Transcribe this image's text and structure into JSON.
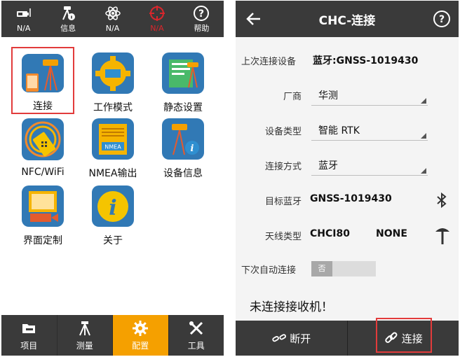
{
  "left": {
    "topbar": [
      {
        "label": "N/A",
        "icon": "receiver-battery-icon",
        "color": "#ffffff"
      },
      {
        "label": "信息",
        "icon": "receiver-info-icon",
        "color": "#ffffff"
      },
      {
        "label": "N/A",
        "icon": "satellite-atom-icon",
        "color": "#ffffff"
      },
      {
        "label": "N/A",
        "icon": "crosshair-target-icon",
        "color": "#d9262c"
      },
      {
        "label": "帮助",
        "icon": "help-circle-icon",
        "color": "#ffffff"
      }
    ],
    "tiles": [
      {
        "label": "连接",
        "icon": "connect-icon",
        "selected": true
      },
      {
        "label": "工作模式",
        "icon": "work-mode-gear-icon",
        "selected": false
      },
      {
        "label": "静态设置",
        "icon": "static-settings-icon",
        "selected": false
      },
      {
        "label": "NFC/WiFi",
        "icon": "nfc-wifi-icon",
        "selected": false
      },
      {
        "label": "NMEA输出",
        "icon": "nmea-output-icon",
        "selected": false
      },
      {
        "label": "设备信息",
        "icon": "device-info-icon",
        "selected": false
      },
      {
        "label": "界面定制",
        "icon": "ui-customize-icon",
        "selected": false
      },
      {
        "label": "关于",
        "icon": "about-icon",
        "selected": false
      }
    ],
    "nmea_badge": "NMEA",
    "bottombar": [
      {
        "label": "项目",
        "icon": "folder-icon",
        "active": false
      },
      {
        "label": "测量",
        "icon": "survey-icon",
        "active": false
      },
      {
        "label": "配置",
        "icon": "gear-icon",
        "active": true
      },
      {
        "label": "工具",
        "icon": "tools-icon",
        "active": false
      }
    ],
    "accent": "#f5a000"
  },
  "right": {
    "title": "CHC-连接",
    "last_device": {
      "label": "上次连接设备",
      "value": "蓝牙:GNSS-1019430"
    },
    "manufacturer": {
      "label": "厂商",
      "value": "华测"
    },
    "device_type": {
      "label": "设备类型",
      "value": "智能 RTK"
    },
    "connect_mode": {
      "label": "连接方式",
      "value": "蓝牙"
    },
    "target_bt": {
      "label": "目标蓝牙",
      "value": "GNSS-1019430",
      "icon": "bluetooth-icon"
    },
    "antenna": {
      "label": "天线类型",
      "value": "CHCI80",
      "extra": "NONE",
      "icon": "antenna-icon"
    },
    "auto_connect": {
      "label": "下次自动连接",
      "value": "否"
    },
    "status": "未连接接收机！",
    "disconnect_label": "断开",
    "connect_label": "连接"
  }
}
